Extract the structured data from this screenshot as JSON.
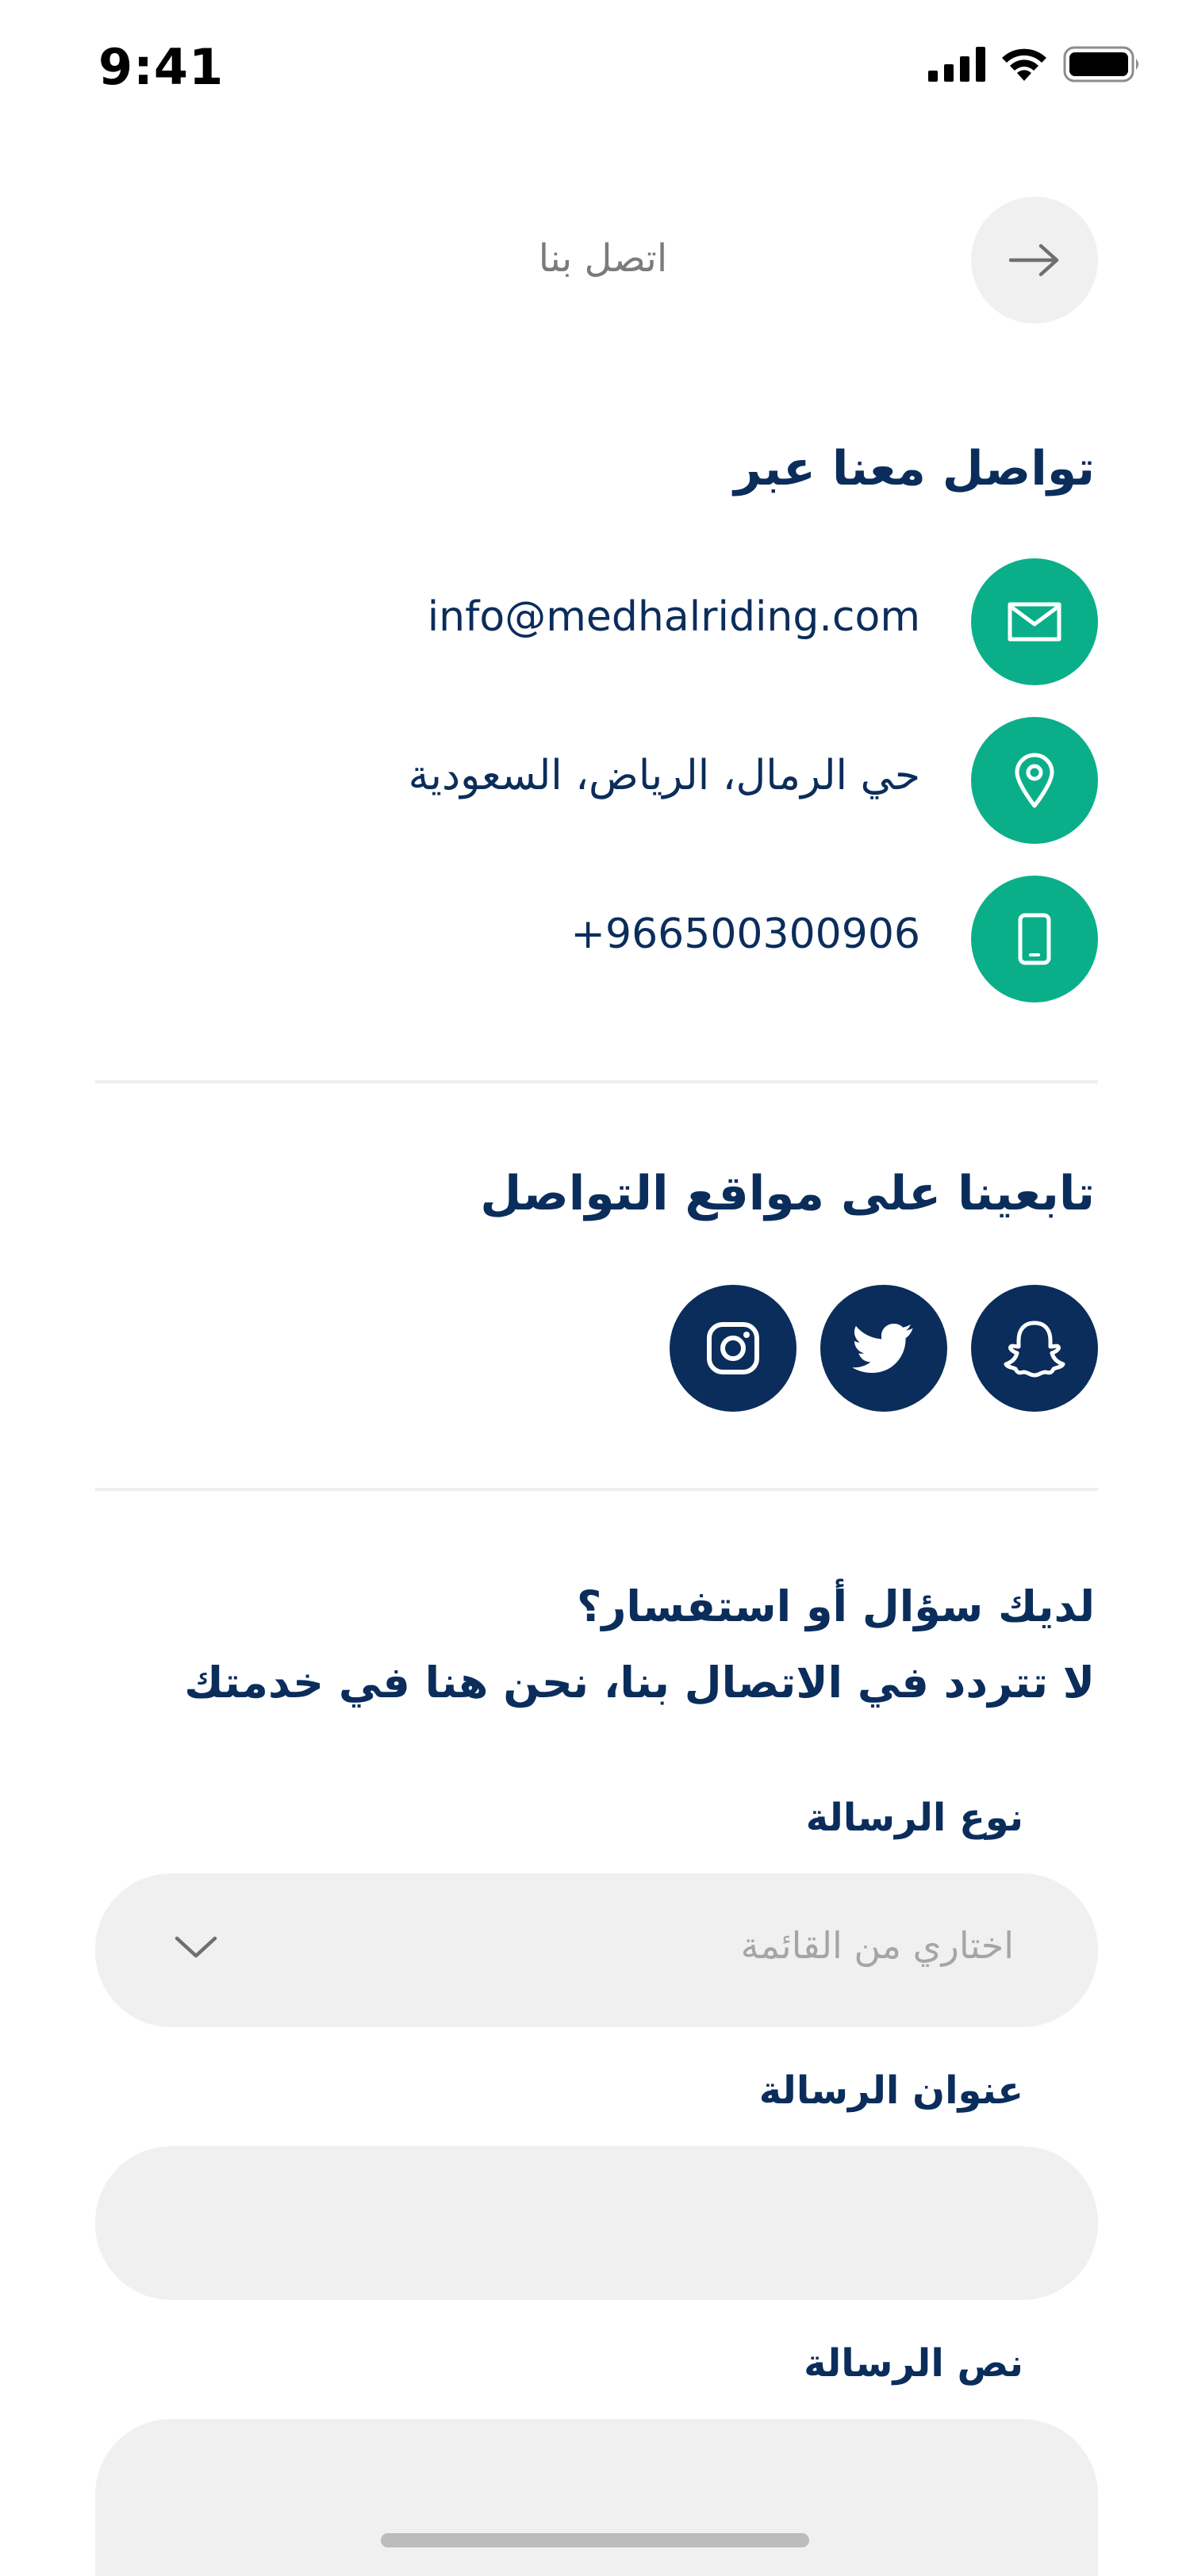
{
  "status_bar": {
    "time": "9:41"
  },
  "header": {
    "title": "اتصل بنا"
  },
  "contact": {
    "heading": "تواصل معنا عبر",
    "email": "info@medhalriding.com",
    "address": "حي الرمال، الرياض، السعودية",
    "phone": "+966500300906",
    "accent_color": "#0aaf8a"
  },
  "social": {
    "heading": "تابعينا على مواقع التواصل",
    "items": [
      "snapchat",
      "twitter",
      "instagram"
    ],
    "color": "#0b2d5b"
  },
  "form": {
    "intro_line1": "لديك سؤال أو استفسار؟",
    "intro_line2": "لا تتردد في الاتصال بنا، نحن هنا في خدمتك",
    "type_label": "نوع الرسالة",
    "type_placeholder": "اختاري من القائمة",
    "subject_label": "عنوان الرسالة",
    "subject_value": "",
    "body_label": "نص الرسالة",
    "body_value": ""
  }
}
